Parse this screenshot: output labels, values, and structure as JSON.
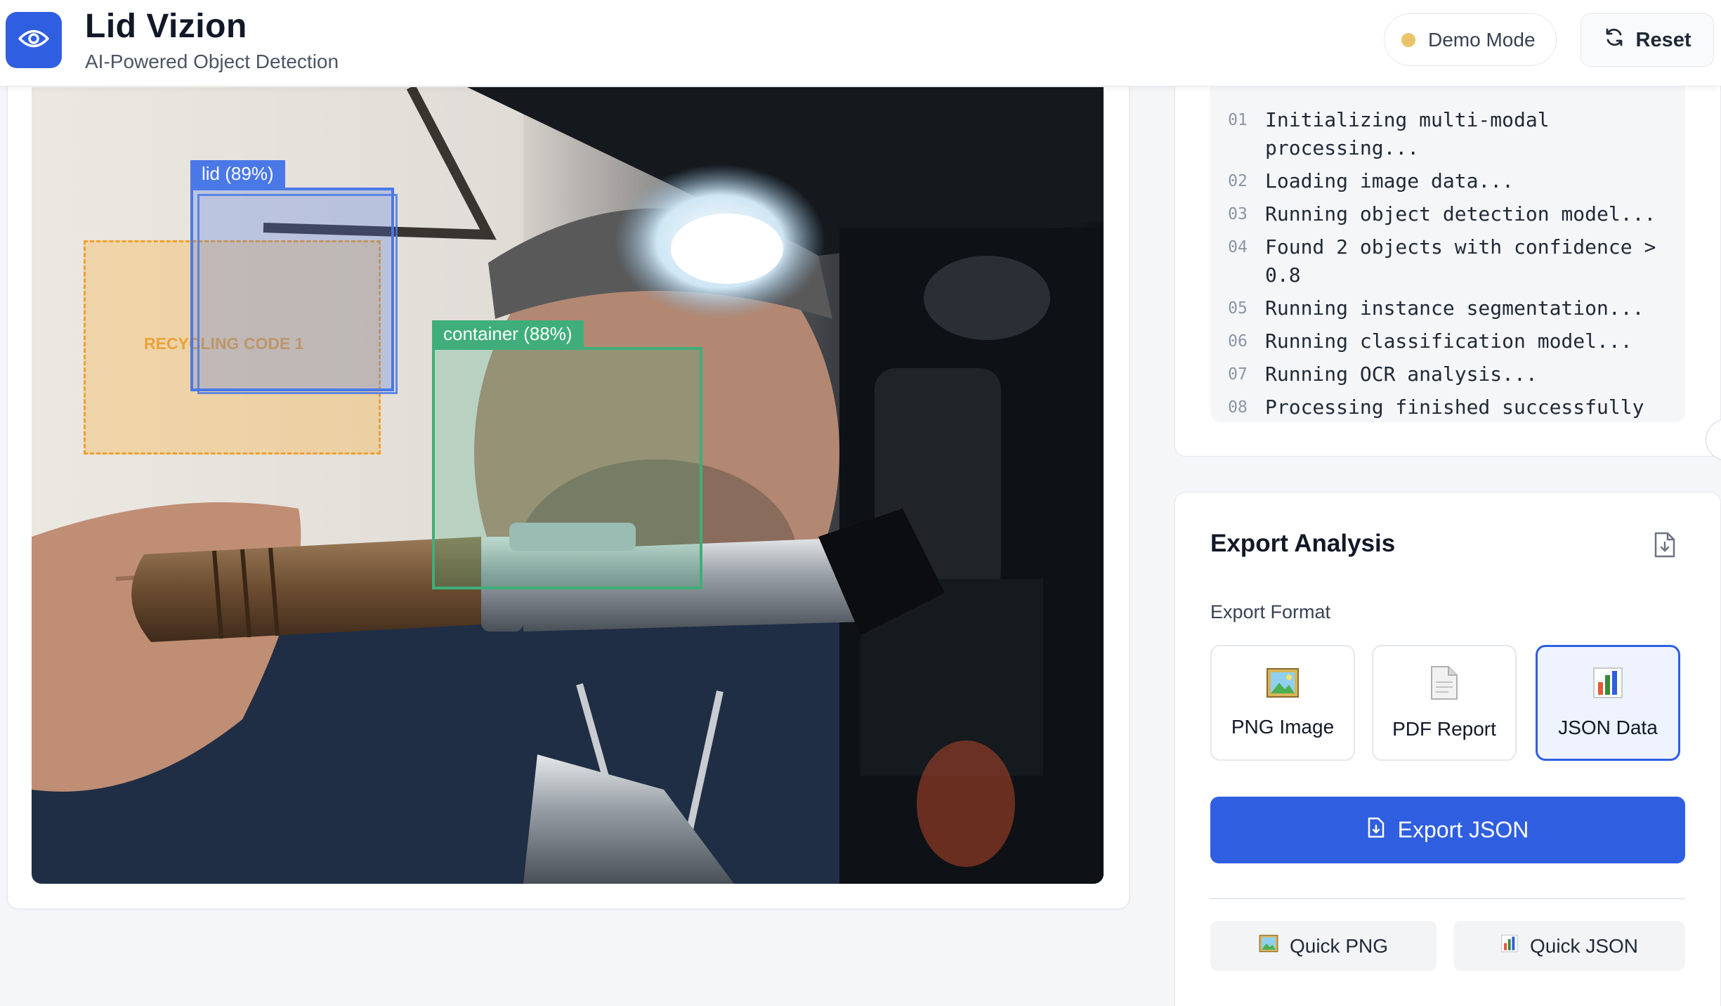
{
  "header": {
    "title": "Lid Vizion",
    "subtitle": "AI-Powered Object Detection",
    "demo_label": "Demo Mode",
    "reset_label": "Reset",
    "brand_color": "#2f5fe0"
  },
  "image_panel": {
    "detections": [
      {
        "label": "lid (89%)",
        "color": "#4a78e6"
      },
      {
        "label": "container (88%)",
        "color": "#3fae7a"
      }
    ],
    "ocr_region": {
      "label": "RECYCLING CODE 1",
      "color": "#f0a030"
    }
  },
  "log": {
    "lines": [
      {
        "num": "01",
        "text": "Initializing multi-modal processing..."
      },
      {
        "num": "02",
        "text": "Loading image data..."
      },
      {
        "num": "03",
        "text": "Running object detection model..."
      },
      {
        "num": "04",
        "text": "Found 2 objects with confidence > 0.8"
      },
      {
        "num": "05",
        "text": "Running instance segmentation..."
      },
      {
        "num": "06",
        "text": "Running classification model..."
      },
      {
        "num": "07",
        "text": "Running OCR analysis..."
      },
      {
        "num": "08",
        "text": "Processing finished successfully"
      }
    ]
  },
  "export": {
    "title": "Export Analysis",
    "format_label": "Export Format",
    "formats": [
      {
        "label": "PNG Image",
        "icon": "picture-icon",
        "selected": false
      },
      {
        "label": "PDF Report",
        "icon": "document-icon",
        "selected": false
      },
      {
        "label": "JSON Data",
        "icon": "bar-chart-icon",
        "selected": true
      }
    ],
    "export_button": "Export JSON",
    "quick_png": "Quick PNG",
    "quick_json": "Quick JSON"
  }
}
